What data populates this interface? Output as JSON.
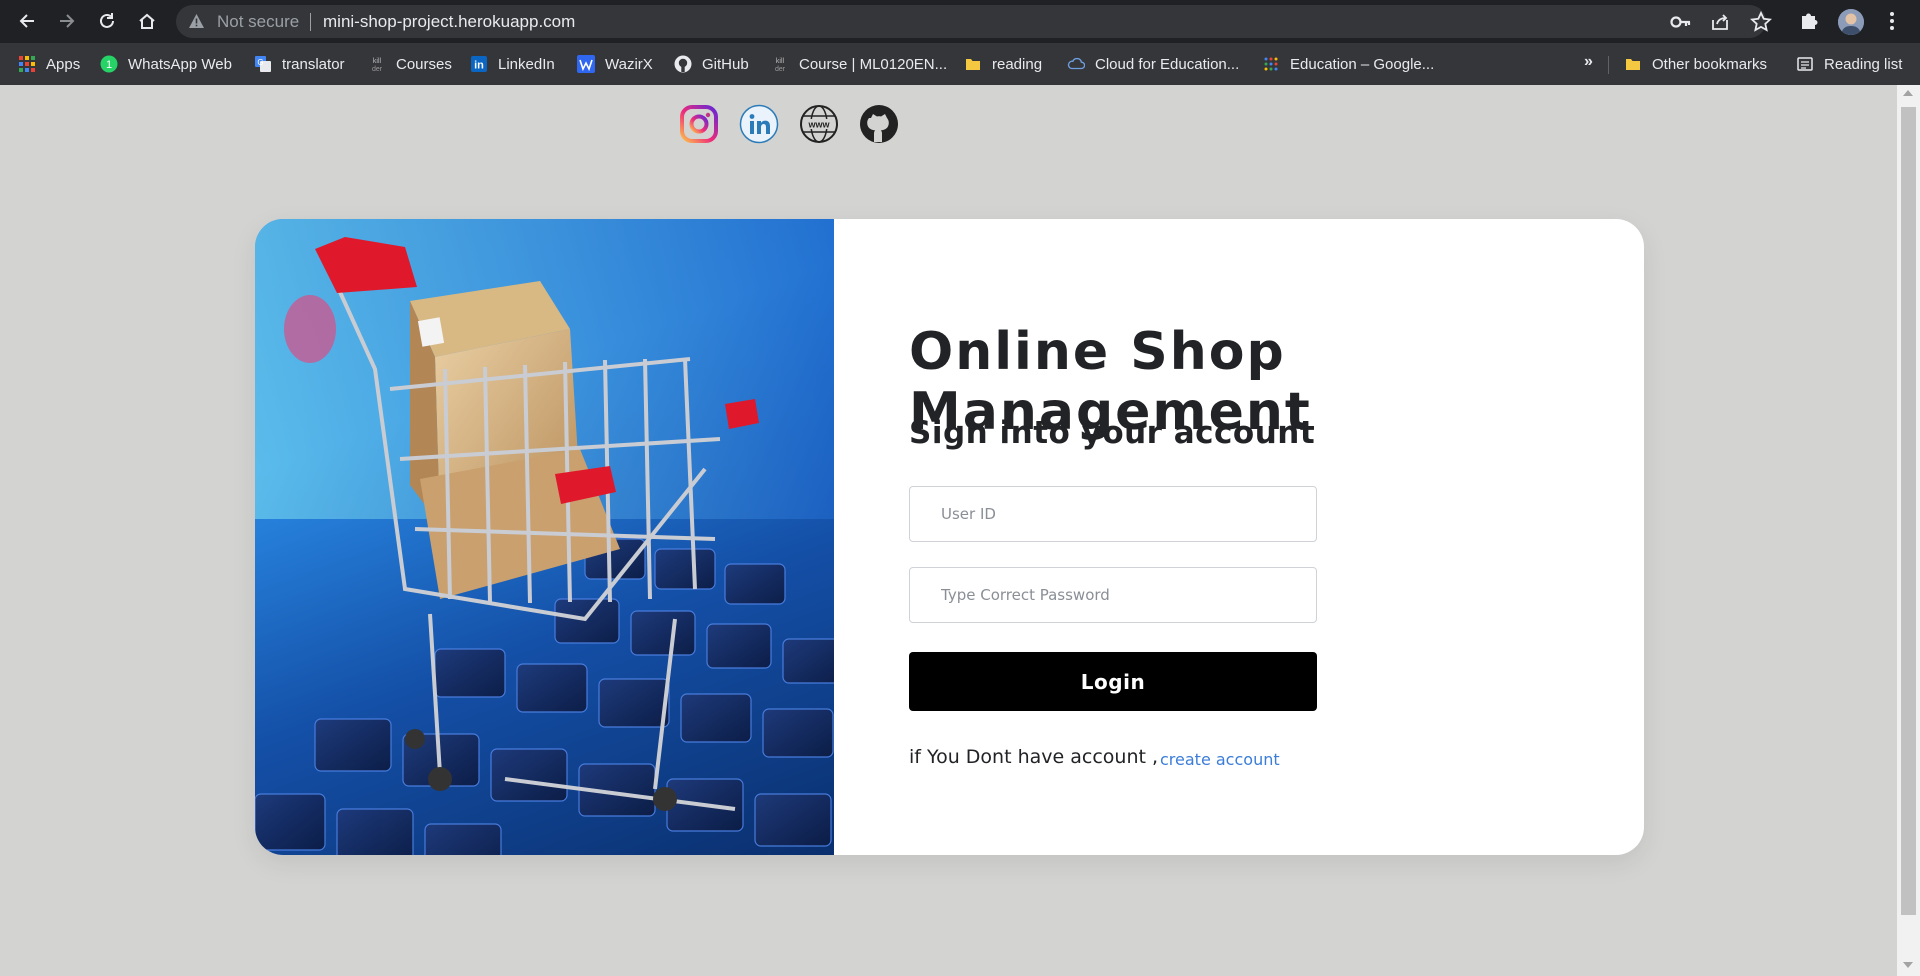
{
  "browser": {
    "security_label": "Not secure",
    "url": "mini-shop-project.herokuapp.com",
    "bookmarks": [
      {
        "label": "Apps",
        "icon": "apps-grid-icon"
      },
      {
        "label": "WhatsApp Web",
        "icon": "whatsapp-icon"
      },
      {
        "label": "translator",
        "icon": "google-translate-icon"
      },
      {
        "label": "Courses",
        "icon": "skillsbuilder-icon"
      },
      {
        "label": "LinkedIn",
        "icon": "linkedin-icon"
      },
      {
        "label": "WazirX",
        "icon": "wazirx-icon"
      },
      {
        "label": "GitHub",
        "icon": "github-icon"
      },
      {
        "label": "Course | ML0120EN...",
        "icon": "skillsbuilder-icon"
      },
      {
        "label": "reading",
        "icon": "folder-icon"
      },
      {
        "label": "Cloud for Education...",
        "icon": "ibm-cloud-icon"
      },
      {
        "label": "Education – Google...",
        "icon": "google-dots-icon"
      }
    ],
    "overflow_label": "»",
    "other_bookmarks": "Other bookmarks",
    "reading_list": "Reading list"
  },
  "social_links": [
    "instagram-icon",
    "linkedin-icon",
    "website-www-icon",
    "github-icon"
  ],
  "login": {
    "title": "Online Shop Management",
    "subtitle": "Sign into your account",
    "user_id_placeholder": "User ID",
    "password_placeholder": "Type Correct Password",
    "login_button": "Login",
    "no_account_text": "if You Dont have account ,",
    "create_account_link": "create account"
  },
  "colors": {
    "page_background": "#d3d3d1",
    "card_background": "#ffffff",
    "button_background": "#000000",
    "link": "#3b7dd8",
    "cart_red": "#e0182b"
  }
}
